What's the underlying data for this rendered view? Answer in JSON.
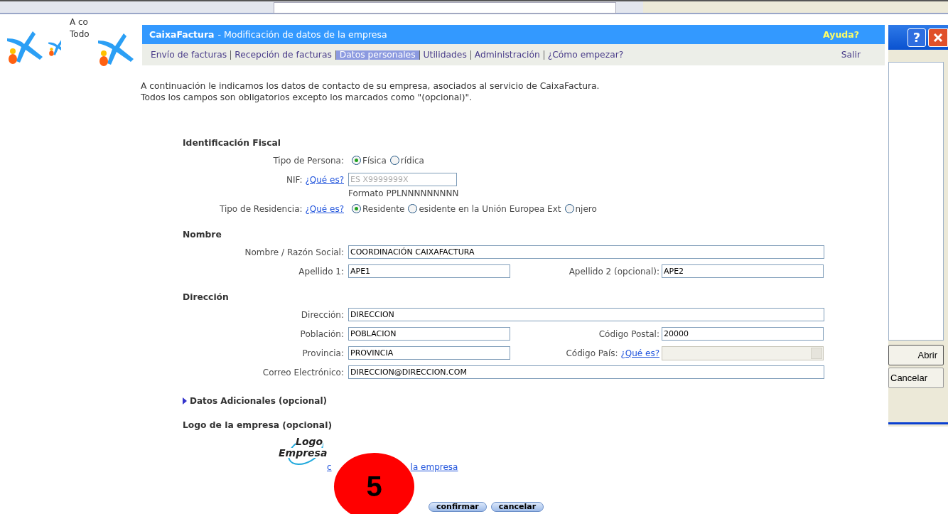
{
  "background_window": {
    "text_lines": [
      "A co",
      "Todo"
    ]
  },
  "app": {
    "brand": "CaixaFactura",
    "page_title": "- Modificación de datos de la empresa",
    "help": "Ayuda?"
  },
  "nav": {
    "items": [
      {
        "label": "Envío de facturas",
        "selected": false
      },
      {
        "label": "Recepción de facturas",
        "selected": false
      },
      {
        "label": "Datos personales",
        "selected": true
      },
      {
        "label": "Utilidades",
        "selected": false
      },
      {
        "label": "Administración",
        "selected": false
      },
      {
        "label": "¿Cómo empezar?",
        "selected": false
      }
    ],
    "logout": "Salir"
  },
  "intro": [
    "A continuación le indicamos los datos de contacto de su empresa, asociados al servicio de CaixaFactura.",
    "Todos los campos son obligatorios excepto los marcados como \"(opcional)\"."
  ],
  "sections": [
    {
      "heading": "Identificación Fiscal",
      "rows": [
        {
          "fields": [
            {
              "kind": "radio",
              "label": "Tipo de Persona:",
              "options": [
                {
                  "label": "Física",
                  "selected": true
                },
                {
                  "label": "rídica",
                  "selected": false
                }
              ]
            }
          ]
        },
        {
          "fields": [
            {
              "kind": "short_text",
              "label": "NIF:",
              "link": "¿Qué es?",
              "placeholder": "ES X9999999X",
              "hint": "Formato PPLNNNNNNNNN"
            }
          ]
        },
        {
          "fields": [
            {
              "kind": "radio",
              "label": "Tipo de Residencia:",
              "link": "¿Qué es?",
              "options": [
                {
                  "label": "Residente",
                  "selected": true
                },
                {
                  "label": "esidente en la Unión Europea Ext",
                  "selected": false
                },
                {
                  "label": "njero",
                  "selected": false
                }
              ]
            }
          ]
        }
      ]
    },
    {
      "heading": "Nombre",
      "rows": [
        {
          "fields": [
            {
              "kind": "text",
              "label": "Nombre / Razón Social:",
              "value": "COORDINACIÓN CAIXAFACTURA"
            }
          ]
        },
        {
          "fields": [
            {
              "kind": "text",
              "label": "Apellido 1:",
              "value": "APE1"
            },
            {
              "kind": "text",
              "label": "Apellido 2 (opcional):",
              "value": "APE2"
            }
          ]
        }
      ]
    },
    {
      "heading": "Dirección",
      "rows": [
        {
          "fields": [
            {
              "kind": "text",
              "label": "Dirección:",
              "value": "DIRECCION"
            }
          ]
        },
        {
          "fields": [
            {
              "kind": "text",
              "label": "Población:",
              "value": "POBLACION"
            },
            {
              "kind": "text",
              "label": "Código Postal:",
              "value": "20000"
            }
          ]
        },
        {
          "fields": [
            {
              "kind": "text",
              "label": "Provincia:",
              "value": "PROVINCIA"
            },
            {
              "kind": "select",
              "label": "Código País:",
              "link": "¿Qué es?",
              "disabled": true
            }
          ]
        },
        {
          "fields": [
            {
              "kind": "text",
              "label": "Correo Electrónico:",
              "value": "DIRECCION@DIRECCION.COM"
            }
          ]
        }
      ]
    }
  ],
  "additional": {
    "label": "Datos Adicionales (opcional)",
    "expanded": false
  },
  "logo_section": {
    "heading": "Logo de la empresa (opcional)",
    "logo_lines": [
      "Logo",
      "Empresa"
    ],
    "link_fragments": [
      "c",
      "la empresa"
    ]
  },
  "step_badge": "5",
  "buttons": [
    "confirmar",
    "cancelar"
  ],
  "dialog": {
    "help_button": "?",
    "buttons": [
      "Abrir",
      "Cancelar"
    ]
  }
}
